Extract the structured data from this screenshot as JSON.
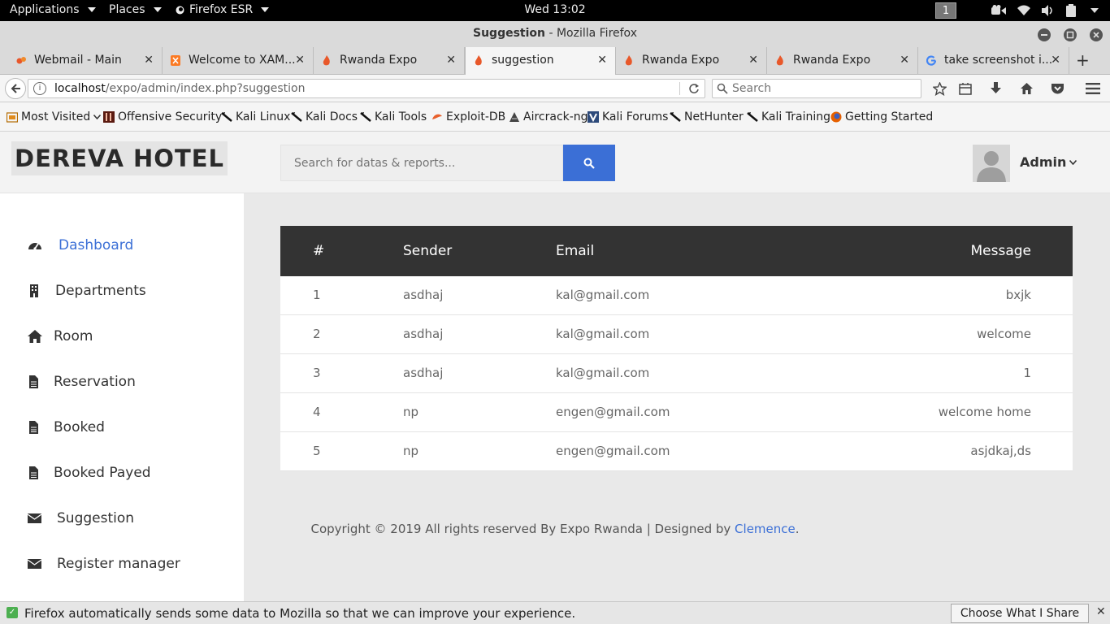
{
  "system_bar": {
    "applications": "Applications",
    "places": "Places",
    "browser_menu": "Firefox ESR",
    "clock": "Wed 13:02",
    "workspace": "1"
  },
  "window": {
    "title_page": "Suggestion",
    "title_app": " - Mozilla Firefox"
  },
  "tabs": [
    {
      "label": "Webmail - Main"
    },
    {
      "label": "Welcome to XAM..."
    },
    {
      "label": "Rwanda Expo"
    },
    {
      "label": "suggestion"
    },
    {
      "label": "Rwanda Expo"
    },
    {
      "label": "Rwanda Expo"
    },
    {
      "label": "take screenshot i..."
    }
  ],
  "navbar": {
    "url_host": "localhost",
    "url_path": "/expo/admin/index.php?suggestion",
    "search_placeholder": "Search"
  },
  "bookmarks": [
    "Most Visited",
    "Offensive Security",
    "Kali Linux",
    "Kali Docs",
    "Kali Tools",
    "Exploit-DB",
    "Aircrack-ng",
    "Kali Forums",
    "NetHunter",
    "Kali Training",
    "Getting Started"
  ],
  "app": {
    "logo": "DEREVA HOTEL",
    "search_placeholder": "Search for datas & reports...",
    "user": "Admin",
    "accent_color": "#3b6fd6"
  },
  "sidebar": {
    "items": [
      {
        "label": "Dashboard",
        "icon": "dashboard-icon"
      },
      {
        "label": "Departments",
        "icon": "building-icon"
      },
      {
        "label": "Room",
        "icon": "home-icon"
      },
      {
        "label": "Reservation",
        "icon": "file-icon"
      },
      {
        "label": "Booked",
        "icon": "file-icon"
      },
      {
        "label": "Booked Payed",
        "icon": "file-icon"
      },
      {
        "label": "Suggestion",
        "icon": "envelope-icon"
      },
      {
        "label": "Register manager",
        "icon": "envelope-icon"
      }
    ]
  },
  "table": {
    "headers": {
      "num": "#",
      "sender": "Sender",
      "email": "Email",
      "message": "Message"
    },
    "rows": [
      {
        "num": "1",
        "sender": "asdhaj",
        "email": "kal@gmail.com",
        "message": "bxjk"
      },
      {
        "num": "2",
        "sender": "asdhaj",
        "email": "kal@gmail.com",
        "message": "welcome"
      },
      {
        "num": "3",
        "sender": "asdhaj",
        "email": "kal@gmail.com",
        "message": "1"
      },
      {
        "num": "4",
        "sender": "np",
        "email": "engen@gmail.com",
        "message": "welcome home"
      },
      {
        "num": "5",
        "sender": "np",
        "email": "engen@gmail.com",
        "message": "asjdkaj,ds"
      }
    ]
  },
  "footer": {
    "text": "Copyright © 2019 All rights reserved By Expo Rwanda | Designed by",
    "link": "Clemence",
    "end": "."
  },
  "notification": {
    "text": "Firefox automatically sends some data to Mozilla so that we can improve your experience.",
    "button": "Choose What I Share"
  }
}
